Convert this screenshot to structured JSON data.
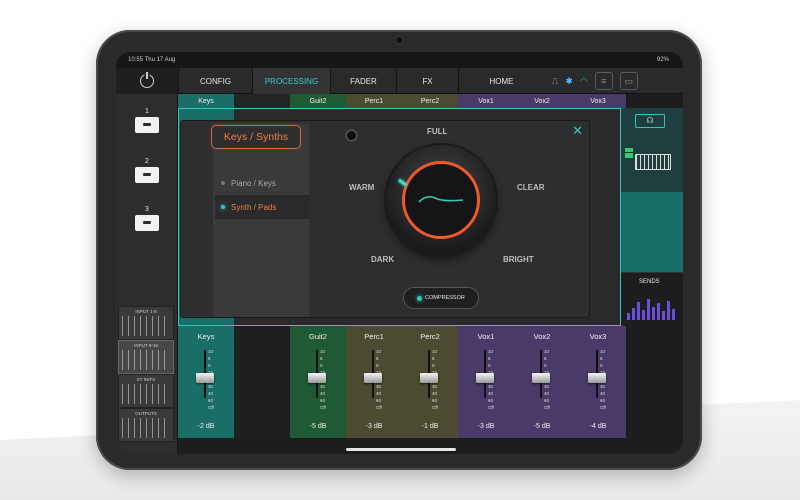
{
  "status": {
    "time": "10:55 Thu 17 Aug",
    "battery": "92%"
  },
  "nav": {
    "tabs": [
      "CONFIG",
      "PROCESSING",
      "FADER",
      "FX",
      "HOME"
    ],
    "active": "PROCESSING",
    "icons": [
      "usb-icon",
      "bluetooth-icon",
      "wifi-icon",
      "menu-icon",
      "folder-icon"
    ]
  },
  "scenes": [
    "1",
    "2",
    "3"
  ],
  "layers": [
    "INPUT 1-8",
    "INPUT 9-16",
    "ST IN/FX",
    "OUTPUTS"
  ],
  "channels": [
    {
      "name": "Keys",
      "color": "#1a6e68",
      "db": "-2 dB",
      "level": 0.72
    },
    {
      "name": "Guit2",
      "color": "#1f5a35",
      "db": "-5 dB",
      "level": 0.72
    },
    {
      "name": "Perc1",
      "color": "#4c4a30",
      "db": "-3 dB",
      "level": 0.72
    },
    {
      "name": "Perc2",
      "color": "#4c4a30",
      "db": "-1 dB",
      "level": 0.72
    },
    {
      "name": "Vox1",
      "color": "#4a3a6a",
      "db": "-3 dB",
      "level": 0.72
    },
    {
      "name": "Vox2",
      "color": "#4a3a6a",
      "db": "-5 dB",
      "level": 0.72
    },
    {
      "name": "Vox3",
      "color": "#4a3a6a",
      "db": "-4 dB",
      "level": 0.72
    }
  ],
  "fader_scale": [
    "10",
    "5",
    "0",
    "10",
    "20",
    "30",
    "40",
    "60",
    "Off"
  ],
  "fader_scale_keys": [
    "10",
    "5",
    "0",
    "10",
    "20",
    "30",
    "40",
    "60",
    "Off"
  ],
  "popup": {
    "title": "Keys / Synths",
    "presets": [
      {
        "label": "Piano / Keys",
        "selected": false
      },
      {
        "label": "Synth / Pads",
        "selected": true
      }
    ],
    "dial": {
      "top": "FULL",
      "left": "WARM",
      "right": "CLEAR",
      "bottom_left": "DARK",
      "bottom_right": "BRIGHT"
    },
    "compressor": "COMPRESSOR",
    "close": "✕"
  },
  "sends": {
    "label": "SENDS",
    "levels": [
      0.3,
      0.55,
      0.8,
      0.45,
      0.95,
      0.6,
      0.75,
      0.4,
      0.85,
      0.5
    ]
  },
  "colors": {
    "accent": "#2ec9b6",
    "orange": "#ef5a2a",
    "logo": "#e5294a"
  },
  "logo": "&"
}
